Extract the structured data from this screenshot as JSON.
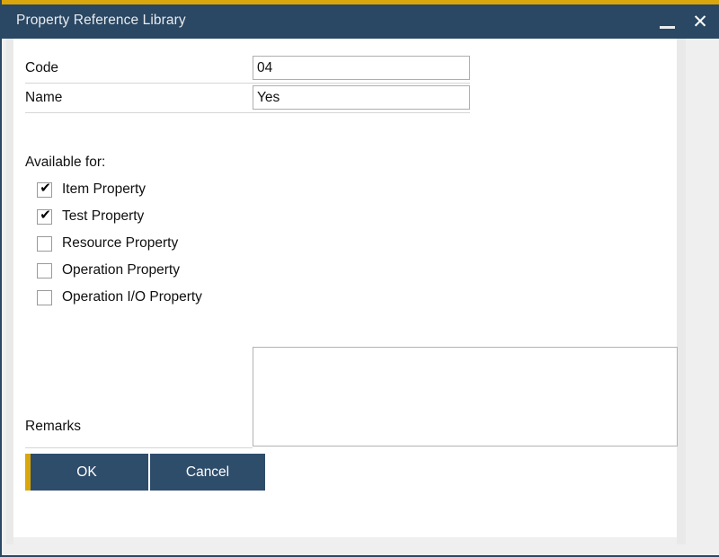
{
  "window": {
    "title": "Property Reference Library",
    "accent_color": "#d9a60c",
    "titlebar_color": "#2a4763",
    "minimize_icon": "minimize-icon",
    "minimize_label": "—",
    "close_icon": "close-icon",
    "close_label": "✕"
  },
  "form": {
    "fields": [
      {
        "label": "Code",
        "value": "04",
        "placeholder": ""
      },
      {
        "label": "Name",
        "value": "Yes",
        "placeholder": ""
      }
    ]
  },
  "available_for": {
    "group_label": "Available for:",
    "check_glyph": "✔",
    "options": [
      {
        "label": "Item Property",
        "checked": true
      },
      {
        "label": "Test Property",
        "checked": true
      },
      {
        "label": "Resource Property",
        "checked": false
      },
      {
        "label": "Operation Property",
        "checked": false
      },
      {
        "label": "Operation I/O Property",
        "checked": false
      }
    ]
  },
  "remarks": {
    "label": "Remarks",
    "value": "",
    "placeholder": ""
  },
  "buttons": {
    "ok_label": "OK",
    "cancel_label": "Cancel",
    "primary_color": "#2e4d6b",
    "focus_accent_color": "#d9a60c"
  }
}
